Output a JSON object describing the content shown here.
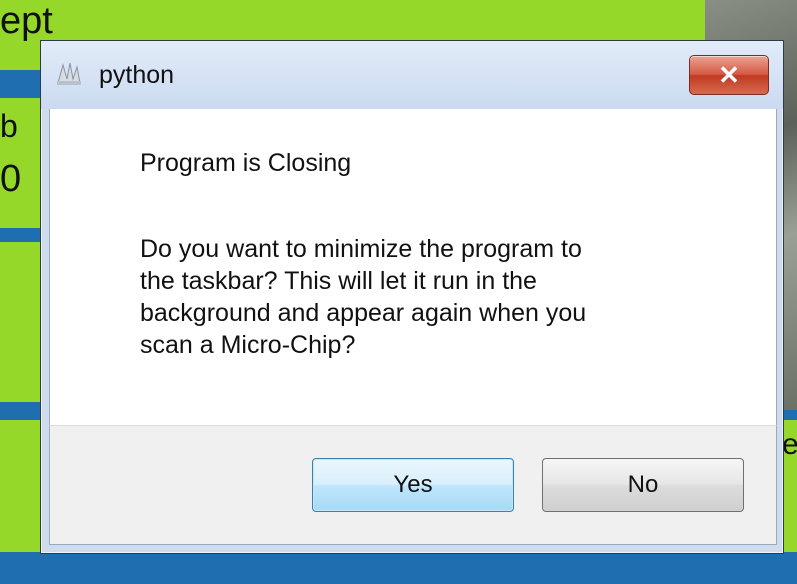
{
  "background": {
    "partial_texts": [
      "ept",
      "b",
      "0",
      "e"
    ]
  },
  "dialog": {
    "title": "python",
    "icon": "python-app-icon",
    "close_label": "✕",
    "message_title": "Program is Closing",
    "message_body": "Do you want to minimize the program to\nthe taskbar? This will let it run in the\nbackground and appear again when you\nscan a Micro-Chip?",
    "buttons": {
      "yes": "Yes",
      "no": "No"
    }
  },
  "colors": {
    "background_green": "#96d82a",
    "background_blue": "#1f6fb0",
    "close_red": "#c03a22"
  }
}
